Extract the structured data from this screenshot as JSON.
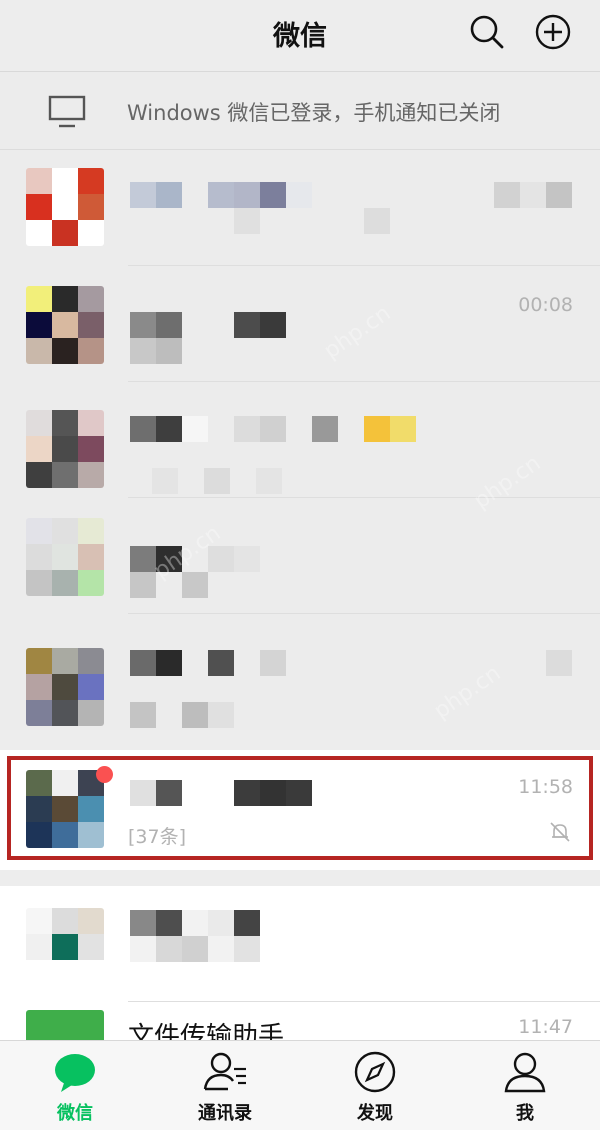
{
  "header": {
    "title": "微信",
    "icons": [
      "search-icon",
      "add-icon"
    ]
  },
  "notice": {
    "text": "Windows 微信已登录，手机通知已关闭",
    "icon": "monitor-icon"
  },
  "chats": [
    {
      "time": "",
      "preview": "",
      "muted": false,
      "unread": false
    },
    {
      "time": "00:08",
      "preview": "",
      "muted": false,
      "unread": false
    },
    {
      "time": "",
      "preview": "",
      "muted": false,
      "unread": false
    },
    {
      "time": "",
      "preview": "",
      "muted": false,
      "unread": false
    },
    {
      "time": "",
      "preview": "",
      "muted": false,
      "unread": false
    },
    {
      "time": "11:58",
      "preview": "[37条]",
      "muted": true,
      "unread": true
    },
    {
      "time": "",
      "preview": "",
      "muted": false,
      "unread": false
    },
    {
      "name": "文件传输助手",
      "time": "11:47"
    }
  ],
  "tabbar": {
    "items": [
      {
        "label": "微信",
        "icon": "chat-icon",
        "active": true
      },
      {
        "label": "通讯录",
        "icon": "contacts-icon",
        "active": false
      },
      {
        "label": "发现",
        "icon": "compass-icon",
        "active": false
      },
      {
        "label": "我",
        "icon": "person-icon",
        "active": false
      }
    ]
  },
  "colors": {
    "accent": "#07c160",
    "highlight_border": "#b62522",
    "unread_dot": "#fa5151"
  },
  "watermark": "php.cn"
}
